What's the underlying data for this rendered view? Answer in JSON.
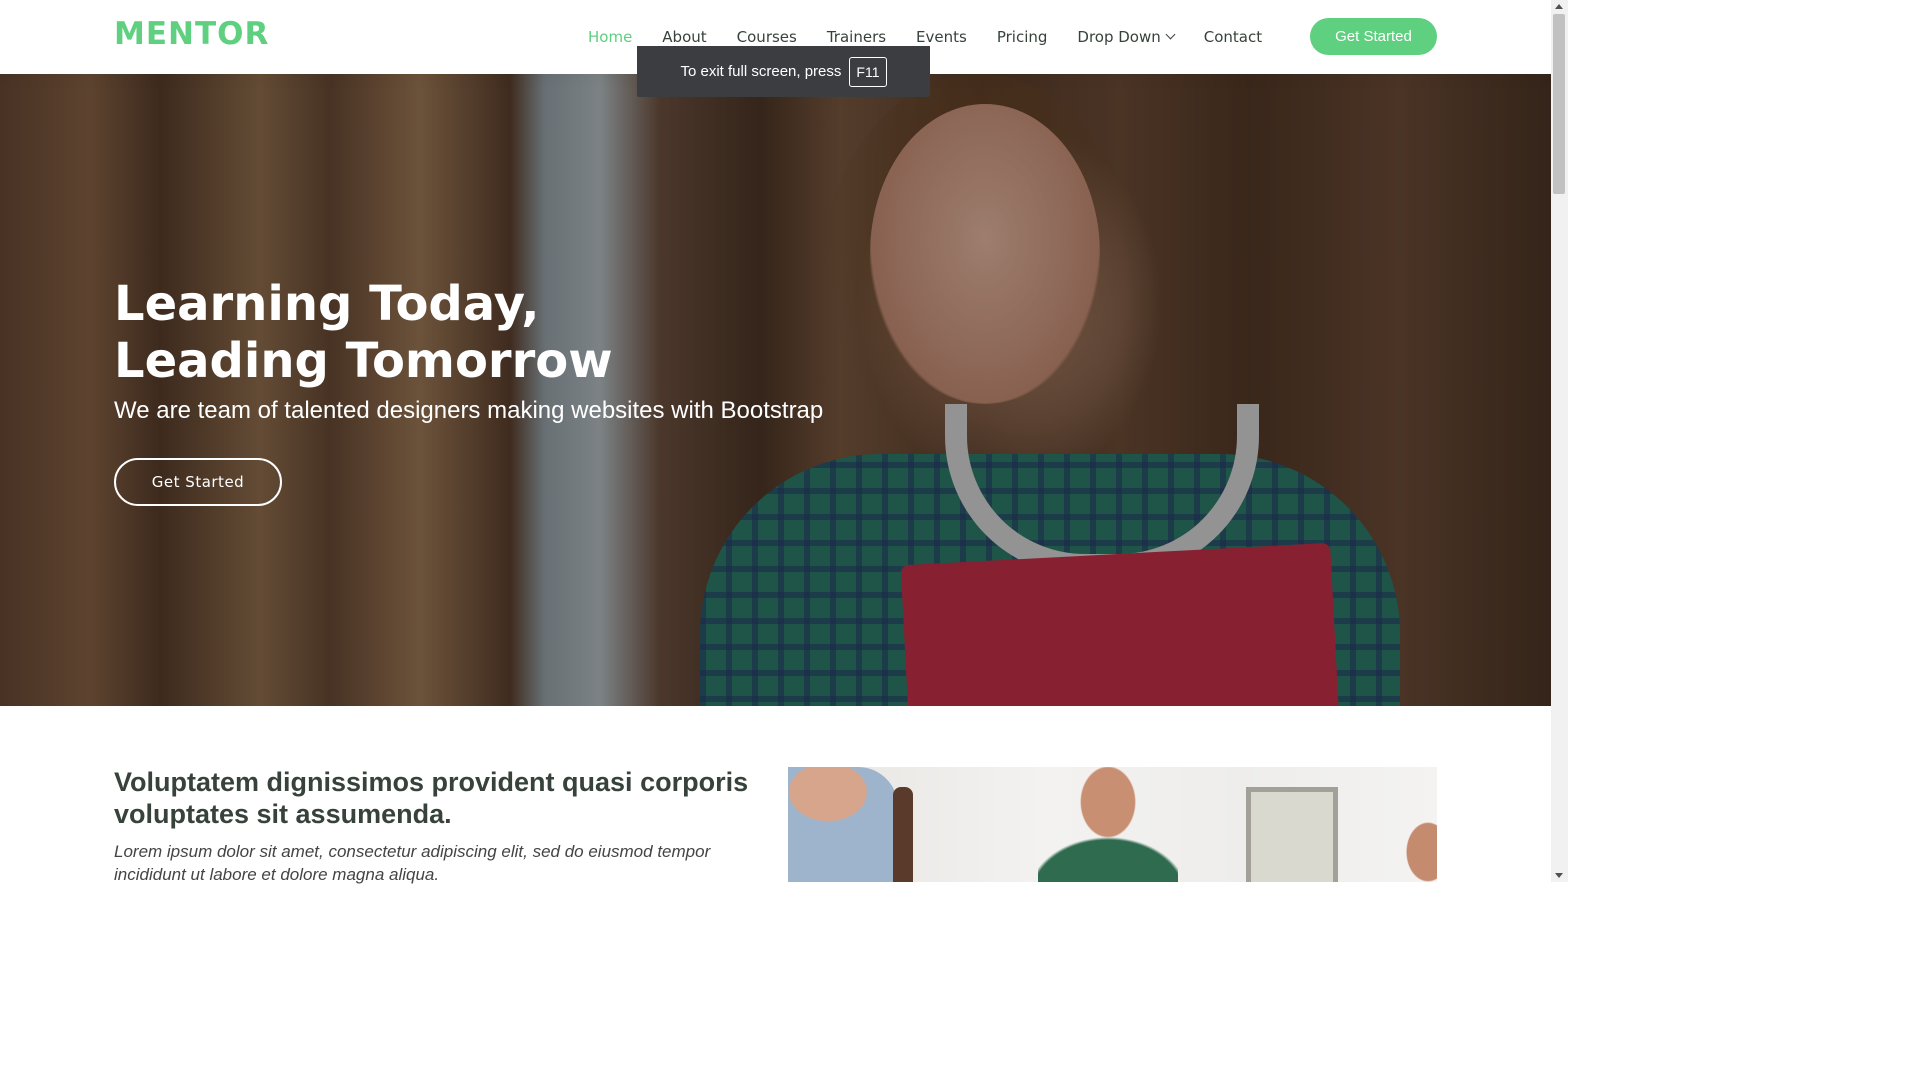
{
  "header": {
    "logo": "MENTOR",
    "nav": [
      {
        "label": "Home"
      },
      {
        "label": "About"
      },
      {
        "label": "Courses"
      },
      {
        "label": "Trainers"
      },
      {
        "label": "Events"
      },
      {
        "label": "Pricing"
      },
      {
        "label": "Drop Down"
      },
      {
        "label": "Contact"
      }
    ],
    "cta_label": "Get Started"
  },
  "fullscreen_notice": {
    "text": "To exit full screen, press",
    "key": "F11"
  },
  "hero": {
    "title_line1": "Learning Today,",
    "title_line2": "Leading Tomorrow",
    "subtitle": "We are team of talented designers making websites with Bootstrap",
    "button_label": "Get Started"
  },
  "about": {
    "title": "Voluptatem dignissimos provident quasi corporis voluptates sit assumenda.",
    "text": "Lorem ipsum dolor sit amet, consectetur adipiscing elit, sed do eiusmod tempor incididunt ut labore et dolore magna aliqua."
  },
  "colors": {
    "accent": "#5fcf80",
    "text": "#37423b"
  }
}
